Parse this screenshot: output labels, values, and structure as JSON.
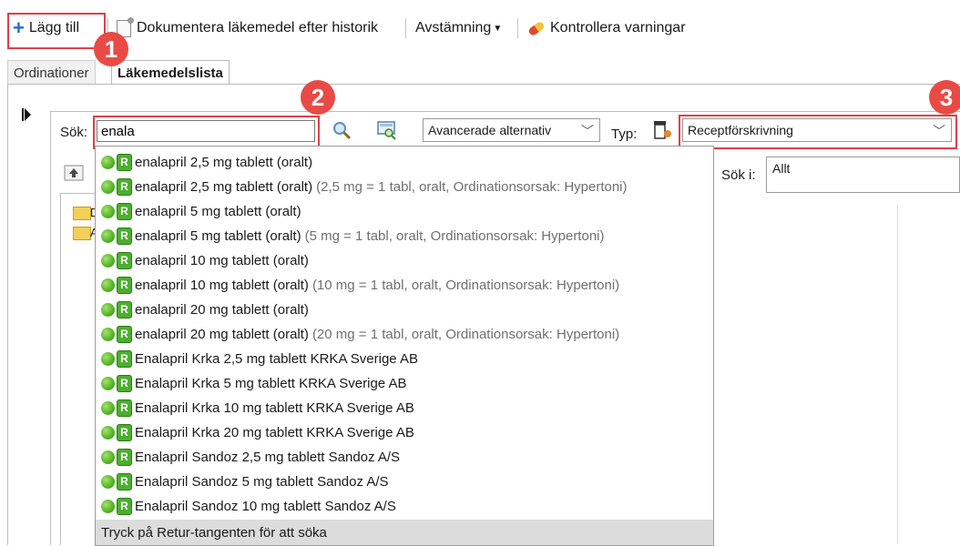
{
  "toolbar": {
    "add_label": "Lägg till",
    "document_label": "Dokumentera läkemedel efter historik",
    "reconcile_label": "Avstämning",
    "warnings_label": "Kontrollera varningar"
  },
  "markers": [
    "1",
    "2",
    "3"
  ],
  "tabs": [
    "Ordinationer",
    "Läkemedelslista"
  ],
  "search": {
    "label": "Sök:",
    "value": "enala",
    "advanced_option": "Avancerade alternativ",
    "type_label": "Typ:",
    "type_value": "Receptförskrivning",
    "search_in_label": "Sök i:",
    "search_in_value": "Allt"
  },
  "tree": [
    "D",
    "A"
  ],
  "results": [
    {
      "name": "enalapril 2,5 mg tablett (oralt)",
      "detail": ""
    },
    {
      "name": "enalapril 2,5 mg tablett (oralt)",
      "detail": "(2,5 mg = 1 tabl, oralt, Ordinationsorsak: Hypertoni)"
    },
    {
      "name": "enalapril 5 mg tablett (oralt)",
      "detail": ""
    },
    {
      "name": "enalapril 5 mg tablett (oralt)",
      "detail": "(5 mg = 1 tabl, oralt, Ordinationsorsak: Hypertoni)"
    },
    {
      "name": "enalapril 10 mg tablett (oralt)",
      "detail": ""
    },
    {
      "name": "enalapril 10 mg tablett (oralt)",
      "detail": "(10 mg = 1 tabl, oralt, Ordinationsorsak: Hypertoni)"
    },
    {
      "name": "enalapril 20 mg tablett (oralt)",
      "detail": ""
    },
    {
      "name": "enalapril 20 mg tablett (oralt)",
      "detail": "(20 mg = 1 tabl, oralt, Ordinationsorsak: Hypertoni)"
    },
    {
      "name": "Enalapril Krka 2,5 mg tablett KRKA Sverige AB",
      "detail": ""
    },
    {
      "name": "Enalapril Krka 5 mg tablett KRKA Sverige AB",
      "detail": ""
    },
    {
      "name": "Enalapril Krka 10 mg tablett KRKA Sverige AB",
      "detail": ""
    },
    {
      "name": "Enalapril Krka 20 mg tablett KRKA Sverige AB",
      "detail": ""
    },
    {
      "name": "Enalapril Sandoz 2,5 mg tablett Sandoz A/S",
      "detail": ""
    },
    {
      "name": "Enalapril Sandoz 5 mg tablett Sandoz A/S",
      "detail": ""
    },
    {
      "name": "Enalapril Sandoz 10 mg tablett Sandoz A/S",
      "detail": ""
    }
  ],
  "badge_letter": "R",
  "footer_hint": "Tryck på Retur-tangenten för att söka",
  "colors": {
    "highlight": "#e0404a",
    "marker": "#e94a45",
    "accent": "#1f6fd1",
    "badge": "#4cae2f"
  },
  "icons": [
    "plus-icon",
    "document-icon",
    "caret-icon",
    "pill-icon",
    "search-icon",
    "search-options-icon",
    "prescription-icon",
    "chevron-down-icon",
    "folder-icon",
    "folder-up-icon",
    "collapse-icon"
  ]
}
